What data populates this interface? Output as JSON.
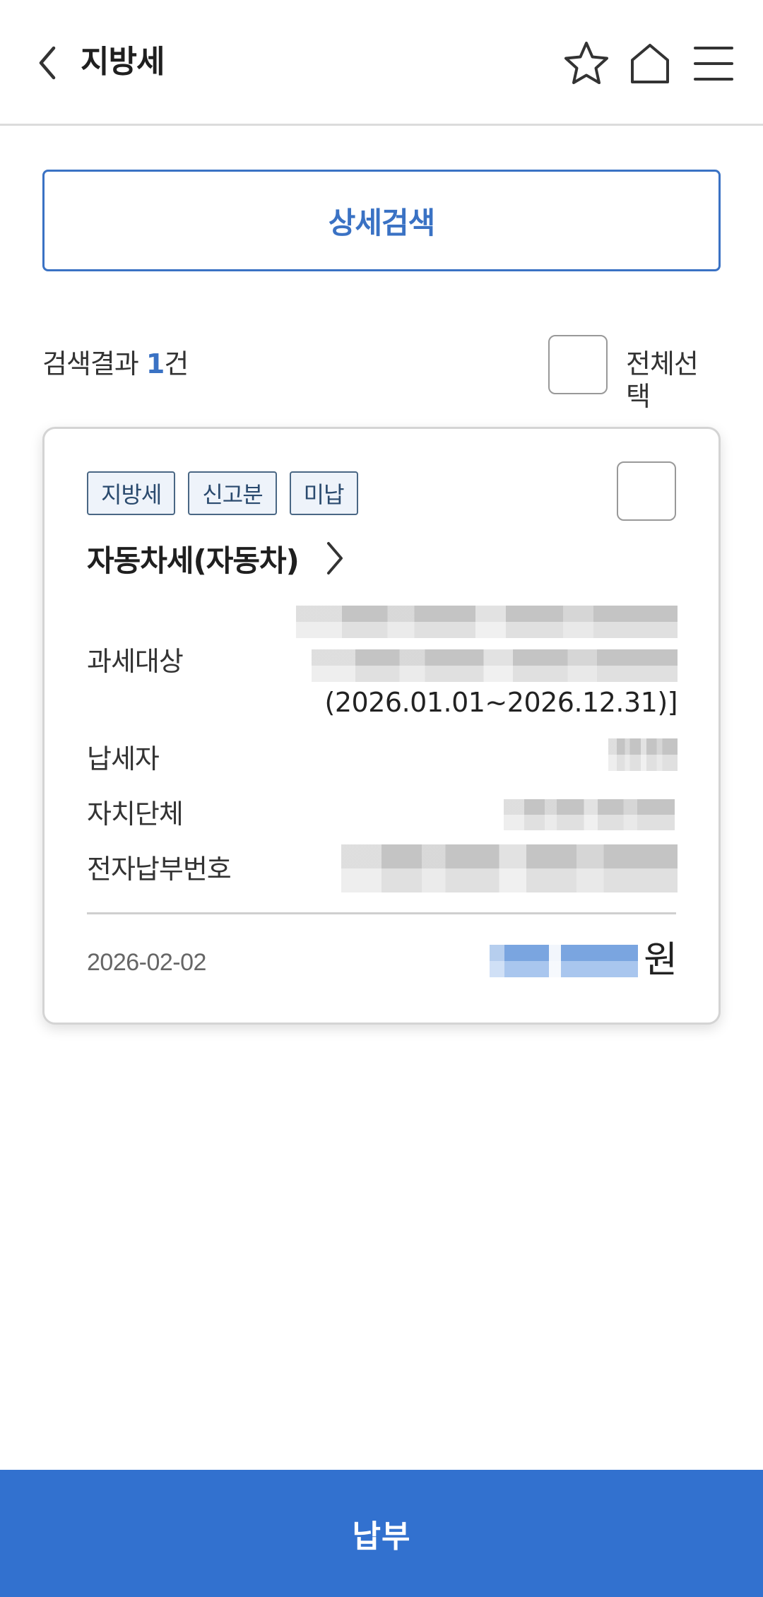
{
  "header": {
    "title": "지방세",
    "icons": [
      "back-arrow-icon",
      "star-icon",
      "home-icon",
      "menu-icon"
    ]
  },
  "search": {
    "detail_search_label": "상세검색"
  },
  "results": {
    "prefix": "검색결과 ",
    "count": "1",
    "suffix": "건",
    "select_all_label": "전체선택"
  },
  "card": {
    "tags": [
      "지방세",
      "신고분",
      "미납"
    ],
    "tax_name": "자동차세(자동차)",
    "fields": {
      "target_label": "과세대상",
      "target_period": "(2026.01.01~2026.12.31)]",
      "taxpayer_label": "납세자",
      "municipality_label": "자치단체",
      "payment_number_label": "전자납부번호"
    },
    "date": "2026-02-02",
    "currency": "원"
  },
  "footer": {
    "pay_label": "납부"
  },
  "colors": {
    "accent": "#3a72c4",
    "pay_button": "#3271cf",
    "tag_border": "#4a6784",
    "tag_bg": "#eef3fa"
  }
}
